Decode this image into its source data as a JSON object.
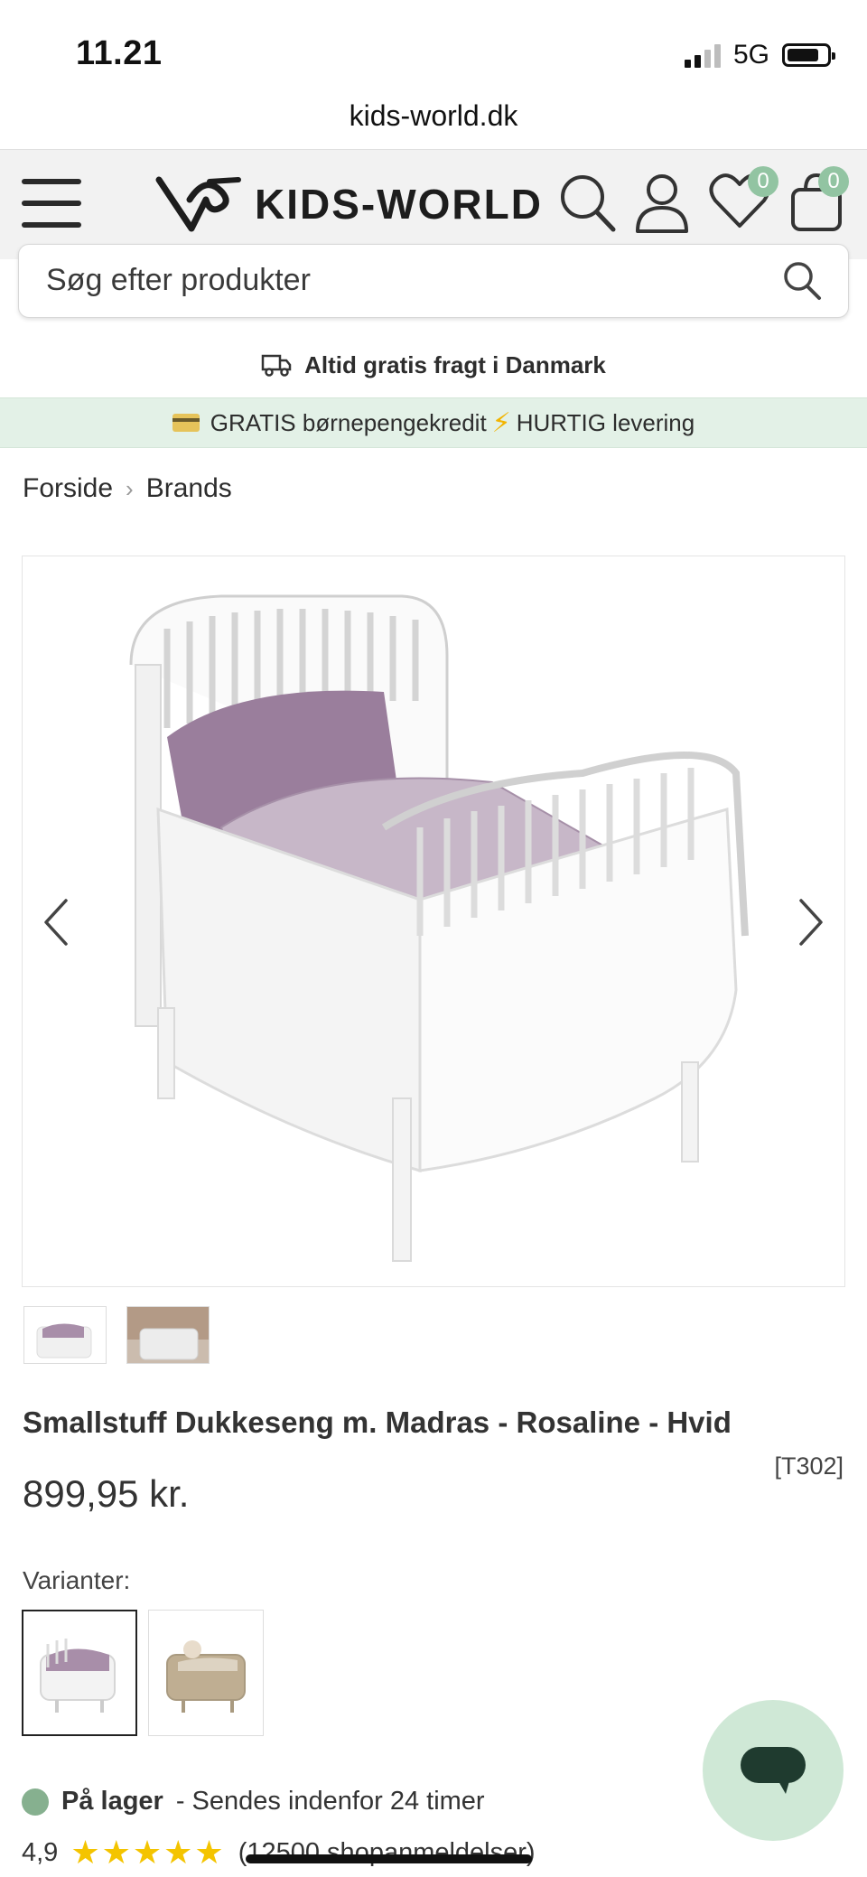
{
  "status_bar": {
    "time": "11.21",
    "network": "5G"
  },
  "browser": {
    "url": "kids-world.dk"
  },
  "header": {
    "logo_text": "KIDS-WORLD",
    "wishlist_count": "0",
    "cart_count": "0"
  },
  "search": {
    "placeholder": "Søg efter produkter"
  },
  "shipping_banner": {
    "text": "Altid gratis fragt i Danmark"
  },
  "promo_banner": {
    "part1": "GRATIS børnepengekredit",
    "part2": "HURTIG levering"
  },
  "breadcrumb": [
    "Forside",
    "Brands"
  ],
  "product": {
    "title": "Smallstuff Dukkeseng m. Madras - Rosaline - Hvid",
    "sku": "[T302]",
    "price": "899,95 kr.",
    "variants_label": "Varianter:",
    "stock_label": "På lager",
    "stock_detail": "- Sendes indenfor 24 timer",
    "rating_value": "4,9",
    "stars": "★★★★★",
    "reviews_text": "(12500 shopanmeldelser)"
  },
  "colors": {
    "accent_green": "#92c4a2",
    "promo_bg": "#e3f1e7",
    "star": "#f4c400",
    "chat_bg": "#cfe8d6",
    "chat_bubble": "#1f3b2f"
  }
}
